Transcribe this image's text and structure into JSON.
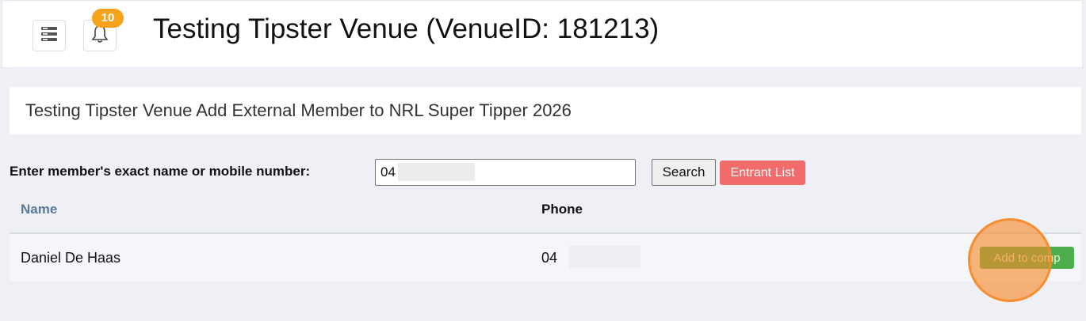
{
  "header": {
    "notification_count": "10",
    "title": "Testing Tipster Venue (VenueID: 181213)"
  },
  "subheader": {
    "title": "Testing Tipster Venue Add External Member to NRL Super Tipper 2026"
  },
  "search": {
    "label": "Enter member's exact name or mobile number:",
    "value": "04",
    "search_button": "Search",
    "entrant_list_button": "Entrant List"
  },
  "table": {
    "columns": [
      "Name",
      "Phone"
    ],
    "rows": [
      {
        "name": "Daniel De Haas",
        "phone": "04",
        "action": "Add to comp"
      }
    ]
  },
  "icons": {
    "menu": "server-menu-icon",
    "notifications": "bell-icon"
  },
  "colors": {
    "badge": "#f7a21b",
    "entrant_list": "#f36c6c",
    "add_to_comp": "#4cae4c",
    "name_header": "#5b7896",
    "click_highlight": "#f78928"
  }
}
